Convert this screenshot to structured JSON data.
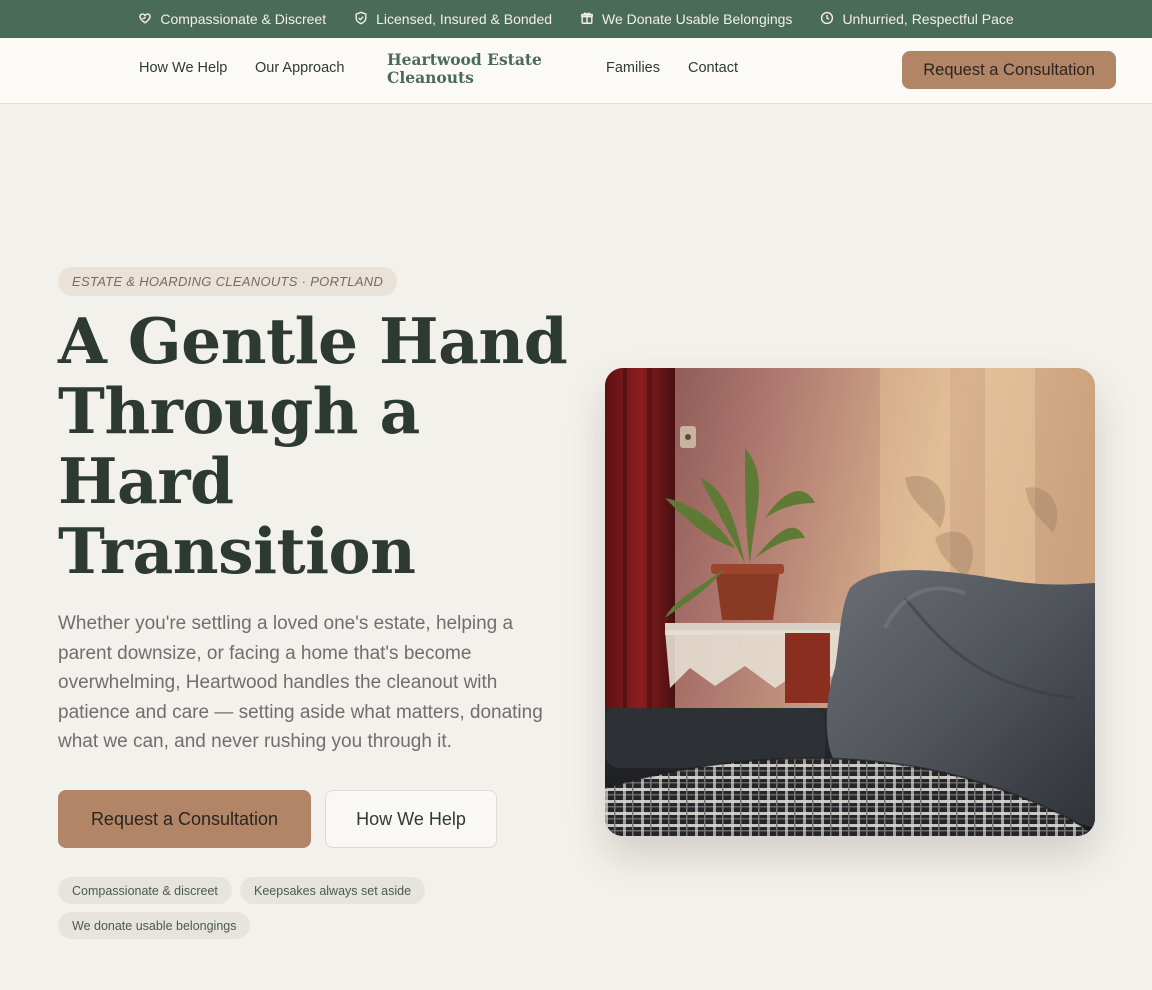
{
  "topbar": {
    "items": [
      {
        "icon": "heart-hands-icon",
        "label": "Compassionate & Discreet"
      },
      {
        "icon": "shield-icon",
        "label": "Licensed, Insured & Bonded"
      },
      {
        "icon": "gift-icon",
        "label": "We Donate Usable Belongings"
      },
      {
        "icon": "clock-icon",
        "label": "Unhurried, Respectful Pace"
      }
    ]
  },
  "nav": {
    "links": [
      "How We Help",
      "Our Approach",
      "Families",
      "Contact"
    ],
    "brand": "Heartwood Estate Cleanouts",
    "cta": "Request a Consultation"
  },
  "hero": {
    "eyebrow": "ESTATE & HOARDING CLEANOUTS · PORTLAND",
    "headline": "A Gentle Hand Through a Hard Transition",
    "lede": "Whether you're settling a loved one's estate, helping a parent downsize, or facing a home that's become overwhelming, Heartwood handles the cleanout with patience and care — setting aside what matters, donating what we can, and never rushing you through it.",
    "primary_cta": "Request a Consultation",
    "secondary_cta": "How We Help",
    "chips": [
      "Compassionate & discreet",
      "Keepsakes always set aside",
      "We donate usable belongings"
    ]
  },
  "colors": {
    "brand_green": "#4a6b57",
    "accent_tan": "#b18566",
    "background": "#f3f1ec"
  }
}
